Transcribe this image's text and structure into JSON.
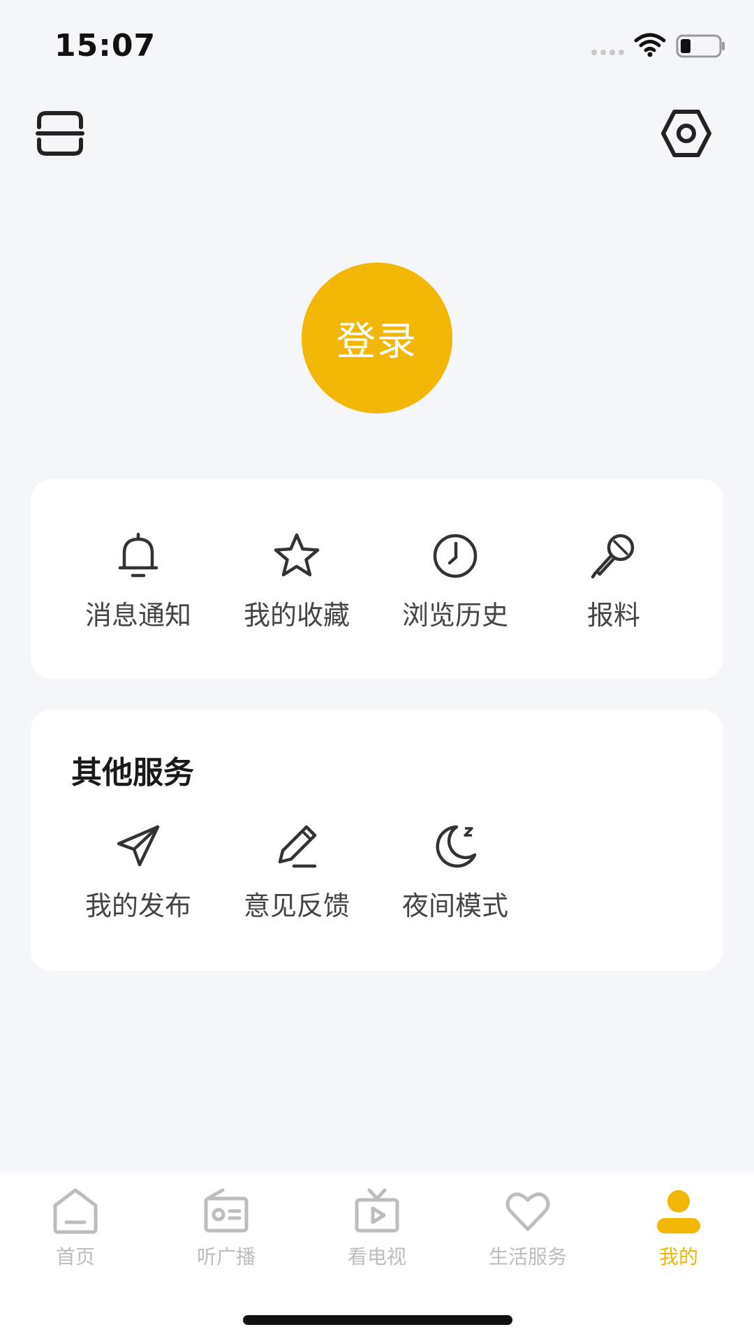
{
  "status_bar": {
    "time": "15:07"
  },
  "header": {
    "scan_icon": "scan-icon",
    "settings_icon": "settings-icon"
  },
  "login": {
    "label": "登录",
    "color": "#f2b705"
  },
  "quick_actions": [
    {
      "label": "消息通知",
      "icon": "bell-icon"
    },
    {
      "label": "我的收藏",
      "icon": "star-icon"
    },
    {
      "label": "浏览历史",
      "icon": "clock-icon"
    },
    {
      "label": "报料",
      "icon": "microphone-icon"
    }
  ],
  "other_services": {
    "title": "其他服务",
    "items": [
      {
        "label": "我的发布",
        "icon": "paper-plane-icon"
      },
      {
        "label": "意见反馈",
        "icon": "pencil-icon"
      },
      {
        "label": "夜间模式",
        "icon": "moon-icon"
      }
    ]
  },
  "bottom_nav": {
    "active_color": "#f2b705",
    "inactive_color": "#bdbdbd",
    "items": [
      {
        "label": "首页",
        "icon": "home-icon",
        "active": false
      },
      {
        "label": "听广播",
        "icon": "radio-icon",
        "active": false
      },
      {
        "label": "看电视",
        "icon": "tv-icon",
        "active": false
      },
      {
        "label": "生活服务",
        "icon": "heart-icon",
        "active": false
      },
      {
        "label": "我的",
        "icon": "user-icon",
        "active": true
      }
    ]
  }
}
